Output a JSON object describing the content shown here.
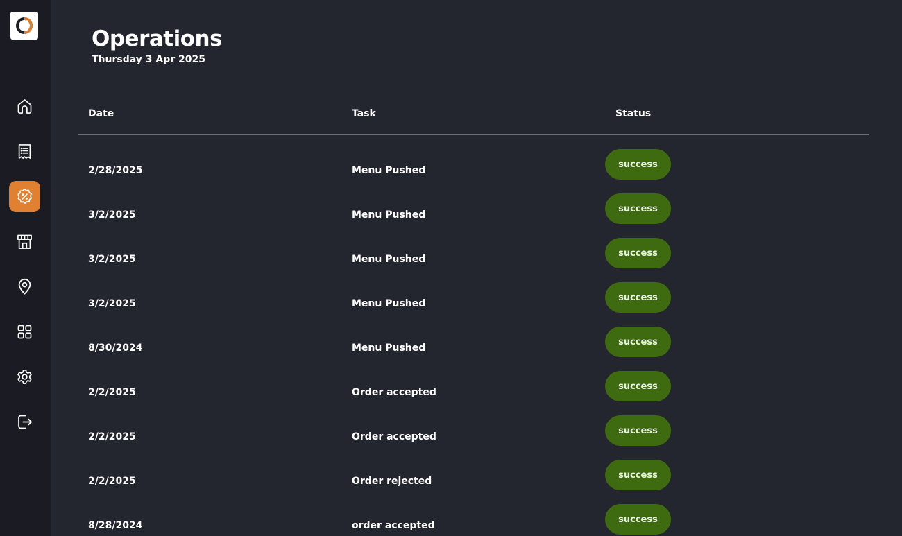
{
  "sidebar": {
    "items": [
      {
        "icon": "home-icon",
        "active": false
      },
      {
        "icon": "receipt-icon",
        "active": false
      },
      {
        "icon": "discount-badge-icon",
        "active": true
      },
      {
        "icon": "store-icon",
        "active": false
      },
      {
        "icon": "location-pin-icon",
        "active": false
      },
      {
        "icon": "apps-grid-icon",
        "active": false
      },
      {
        "icon": "gear-icon",
        "active": false
      },
      {
        "icon": "logout-icon",
        "active": false
      }
    ],
    "accent_color": "#e08030"
  },
  "header": {
    "title": "Operations",
    "date": "Thursday 3 Apr 2025"
  },
  "table": {
    "columns": {
      "date": "Date",
      "task": "Task",
      "status": "Status"
    },
    "rows": [
      {
        "date": "2/28/2025",
        "task": "Menu Pushed",
        "status": "success"
      },
      {
        "date": "3/2/2025",
        "task": "Menu Pushed",
        "status": "success"
      },
      {
        "date": "3/2/2025",
        "task": "Menu Pushed",
        "status": "success"
      },
      {
        "date": "3/2/2025",
        "task": "Menu Pushed",
        "status": "success"
      },
      {
        "date": "8/30/2024",
        "task": "Menu Pushed",
        "status": "success"
      },
      {
        "date": "2/2/2025",
        "task": "Order accepted",
        "status": "success"
      },
      {
        "date": "2/2/2025",
        "task": "Order accepted",
        "status": "success"
      },
      {
        "date": "2/2/2025",
        "task": "Order rejected",
        "status": "success"
      },
      {
        "date": "8/28/2024",
        "task": "order accepted",
        "status": "success"
      }
    ],
    "status_color": "#3f6b10"
  }
}
